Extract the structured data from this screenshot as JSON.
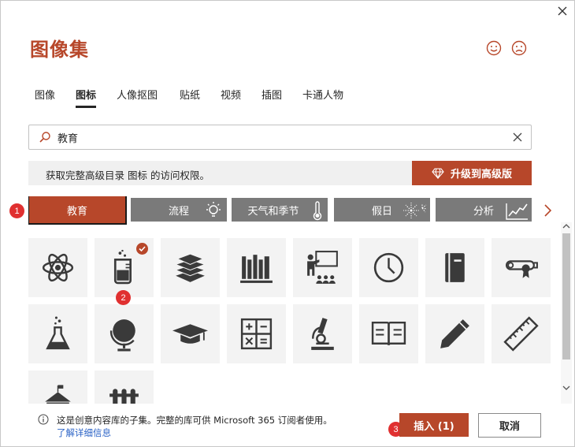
{
  "dialog": {
    "title": "图像集",
    "close_icon": "close-icon"
  },
  "feedback": {
    "smile_icon": "smile-icon",
    "frown_icon": "frown-icon"
  },
  "tabs": [
    {
      "label": "图像",
      "active": false
    },
    {
      "label": "图标",
      "active": true
    },
    {
      "label": "人像抠图",
      "active": false
    },
    {
      "label": "贴纸",
      "active": false
    },
    {
      "label": "视频",
      "active": false
    },
    {
      "label": "插图",
      "active": false
    },
    {
      "label": "卡通人物",
      "active": false
    }
  ],
  "search": {
    "value": "教育",
    "search_icon": "search-icon",
    "clear_icon": "clear-icon"
  },
  "banner": {
    "text": "获取完整高级目录 图标 的访问权限。",
    "upgrade_label": "升级到高级版",
    "upgrade_icon": "diamond-icon"
  },
  "categories": [
    {
      "label": "教育",
      "selected": true
    },
    {
      "label": "流程",
      "icon": "lightbulb-icon"
    },
    {
      "label": "天气和季节",
      "icon": "thermometer-icon"
    },
    {
      "label": "假日",
      "icon": "fireworks-icon"
    },
    {
      "label": "分析",
      "icon": "line-chart-icon"
    }
  ],
  "icons": [
    {
      "name": "atom-icon"
    },
    {
      "name": "beaker-icon",
      "selected": true
    },
    {
      "name": "books-stack-icon"
    },
    {
      "name": "library-books-icon"
    },
    {
      "name": "teacher-icon"
    },
    {
      "name": "clock-icon"
    },
    {
      "name": "notebook-icon"
    },
    {
      "name": "diploma-icon"
    },
    {
      "name": "flask-icon"
    },
    {
      "name": "globe-icon"
    },
    {
      "name": "graduation-cap-icon"
    },
    {
      "name": "calculator-icon"
    },
    {
      "name": "microscope-icon"
    },
    {
      "name": "open-book-icon"
    },
    {
      "name": "pencil-icon"
    },
    {
      "name": "ruler-icon"
    },
    {
      "name": "school-building-icon"
    },
    {
      "name": "test-tubes-icon"
    }
  ],
  "annotations": [
    "1",
    "2",
    "3"
  ],
  "footer": {
    "info_text": "这是创意内容库的子集。完整的库可供 Microsoft 365 订阅者使用。",
    "link": "了解详细信息",
    "insert_label": "插入 (1)",
    "cancel_label": "取消"
  },
  "colors": {
    "accent": "#b7472a",
    "category_bg": "#7a7a7a",
    "annotation": "#e03030"
  }
}
